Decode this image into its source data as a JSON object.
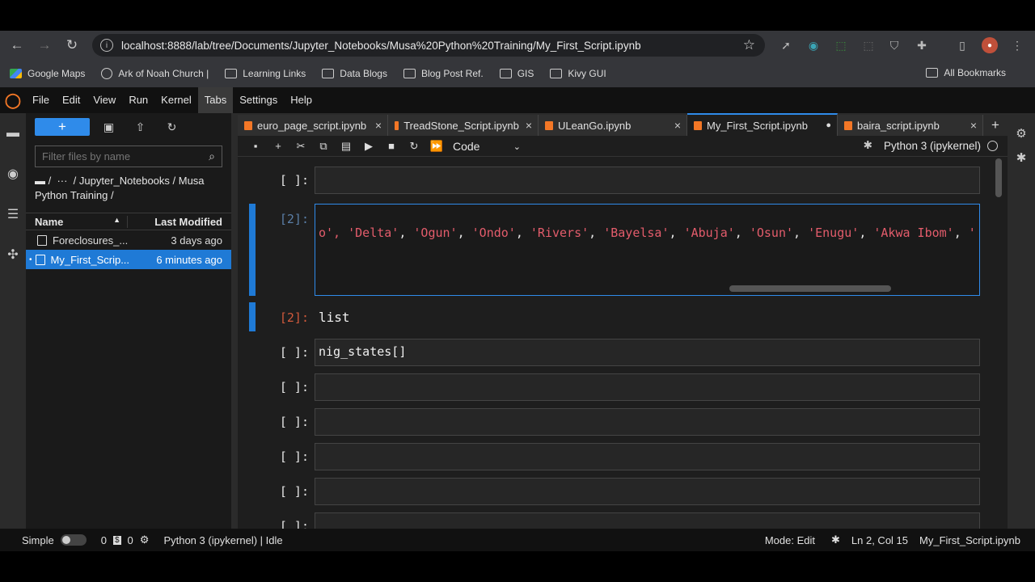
{
  "browser": {
    "url": "localhost:8888/lab/tree/Documents/Jupyter_Notebooks/Musa%20Python%20Training/My_First_Script.ipynb",
    "nav": {
      "back": "←",
      "forward": "→",
      "reload": "↻"
    }
  },
  "bookmarks": {
    "items": [
      {
        "label": "Google Maps",
        "icon": "maps-icon"
      },
      {
        "label": "Ark of Noah Church |",
        "icon": "globe-icon"
      },
      {
        "label": "Learning Links",
        "icon": "folder-icon"
      },
      {
        "label": "Data Blogs",
        "icon": "folder-icon"
      },
      {
        "label": "Blog Post Ref.",
        "icon": "folder-icon"
      },
      {
        "label": "GIS",
        "icon": "folder-icon"
      },
      {
        "label": "Kivy GUI",
        "icon": "folder-icon"
      }
    ],
    "all": "All Bookmarks"
  },
  "menu": {
    "items": [
      "File",
      "Edit",
      "View",
      "Run",
      "Kernel",
      "Tabs",
      "Settings",
      "Help"
    ],
    "active": "Tabs"
  },
  "filebrowser": {
    "new_label": "+",
    "filter_placeholder": "Filter files by name",
    "breadcrumb": "/  ···  / Jupyter_Notebooks / Musa Python Training /",
    "col_name": "Name",
    "col_modified": "Last Modified",
    "files": [
      {
        "name": "Foreclosures_...",
        "modified": "3 days ago",
        "selected": false
      },
      {
        "name": "My_First_Scrip...",
        "modified": "6 minutes ago",
        "selected": true
      }
    ]
  },
  "tabs": [
    {
      "label": "euro_page_script.ipynb",
      "active": false,
      "dirty": false
    },
    {
      "label": "TreadStone_Script.ipynb",
      "active": false,
      "dirty": false
    },
    {
      "label": "ULeanGo.ipynb",
      "active": false,
      "dirty": false
    },
    {
      "label": "My_First_Script.ipynb",
      "active": true,
      "dirty": true
    },
    {
      "label": "baira_script.ipynb",
      "active": false,
      "dirty": false
    }
  ],
  "toolbar": {
    "cell_type": "Code",
    "kernel": "Python 3 (ipykernel)"
  },
  "cells": {
    "c1_prompt": "[ ]:",
    "c2_prompt": "[2]:",
    "c2_code_prefix": "o', ",
    "c2_strings": [
      "'Delta'",
      "'Ogun'",
      "'Ondo'",
      "'Rivers'",
      "'Bayelsa'",
      "'Abuja'",
      "'Osun'",
      "'Enugu'",
      "'Akwa Ibom'",
      "'"
    ],
    "out_prompt": "[2]:",
    "out_text": "list",
    "c3_prompt": "[ ]:",
    "c3_code": "nig_states[]",
    "empty_prompt": "[ ]:"
  },
  "status": {
    "mode_label": "Simple",
    "count_a": "0",
    "count_b": "0",
    "kernel_status": "Python 3 (ipykernel) | Idle",
    "mode": "Mode: Edit",
    "position": "Ln 2, Col 15",
    "filename": "My_First_Script.ipynb"
  }
}
